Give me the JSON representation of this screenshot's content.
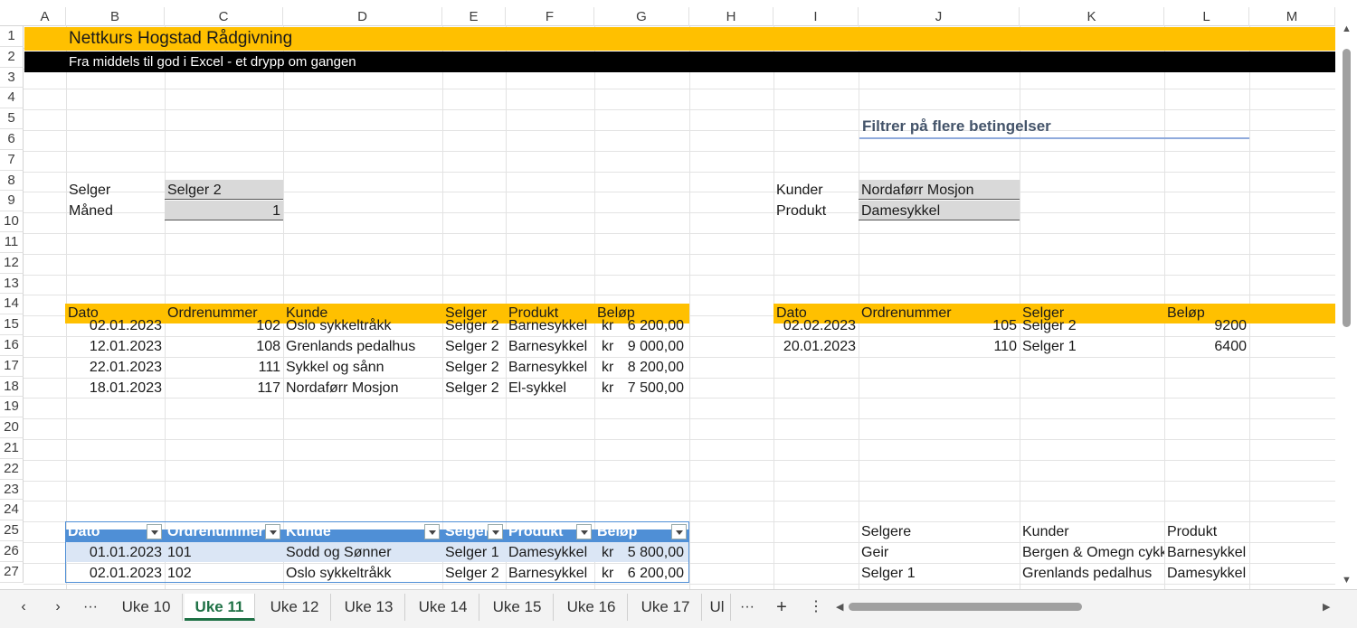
{
  "columns": [
    "A",
    "B",
    "C",
    "D",
    "E",
    "F",
    "G",
    "H",
    "I",
    "J",
    "K",
    "L",
    "M"
  ],
  "rows": [
    "1",
    "2",
    "3",
    "4",
    "5",
    "6",
    "7",
    "8",
    "9",
    "10",
    "11",
    "12",
    "13",
    "14",
    "15",
    "16",
    "17",
    "18",
    "19",
    "20",
    "21",
    "22",
    "23",
    "24",
    "25",
    "26",
    "27"
  ],
  "banner": {
    "title": "Nettkurs Hogstad Rådgivning",
    "subtitle": "Fra middels til god i Excel - et drypp om gangen"
  },
  "section_title": "Filtrer på flere betingelser",
  "criteria_left": {
    "selger_label": "Selger",
    "selger_value": "Selger 2",
    "maned_label": "Måned",
    "maned_value": "1"
  },
  "criteria_right": {
    "kunder_label": "Kunder",
    "kunder_value": "Nordaførr Mosjon",
    "produkt_label": "Produkt",
    "produkt_value": "Damesykkel"
  },
  "result_left": {
    "headers": [
      "Dato",
      "Ordrenummer",
      "Kunde",
      "Selger",
      "Produkt",
      "Beløp"
    ],
    "rows": [
      {
        "dato": "02.01.2023",
        "ordre": "102",
        "kunde": "Oslo sykkeltråkk",
        "selger": "Selger 2",
        "produkt": "Barnesykkel",
        "kr": "kr",
        "belop": "6 200,00"
      },
      {
        "dato": "12.01.2023",
        "ordre": "108",
        "kunde": "Grenlands pedalhus",
        "selger": "Selger 2",
        "produkt": "Barnesykkel",
        "kr": "kr",
        "belop": "9 000,00"
      },
      {
        "dato": "22.01.2023",
        "ordre": "111",
        "kunde": "Sykkel og sånn",
        "selger": "Selger 2",
        "produkt": "Barnesykkel",
        "kr": "kr",
        "belop": "8 200,00"
      },
      {
        "dato": "18.01.2023",
        "ordre": "117",
        "kunde": "Nordaførr Mosjon",
        "selger": "Selger 2",
        "produkt": "El-sykkel",
        "kr": "kr",
        "belop": "7 500,00"
      }
    ]
  },
  "result_right": {
    "headers": [
      "Dato",
      "Ordrenummer",
      "Selger",
      "Beløp"
    ],
    "rows": [
      {
        "dato": "02.02.2023",
        "ordre": "105",
        "selger": "Selger 2",
        "belop": "9200"
      },
      {
        "dato": "20.01.2023",
        "ordre": "110",
        "selger": "Selger 1",
        "belop": "6400"
      }
    ]
  },
  "table": {
    "headers": [
      "Dato",
      "Ordrenummer",
      "Kunde",
      "Selger",
      "Produkt",
      "Beløp"
    ],
    "rows": [
      {
        "dato": "01.01.2023",
        "ordre": "101",
        "kunde": "Sodd og Sønner",
        "selger": "Selger 1",
        "produkt": "Damesykkel",
        "kr": "kr",
        "belop": "5 800,00"
      },
      {
        "dato": "02.01.2023",
        "ordre": "102",
        "kunde": "Oslo sykkeltråkk",
        "selger": "Selger 2",
        "produkt": "Barnesykkel",
        "kr": "kr",
        "belop": "6 200,00"
      }
    ]
  },
  "lists": {
    "headers": [
      "Selgere",
      "Kunder",
      "Produkt"
    ],
    "rows": [
      [
        "Geir",
        "Bergen & Omegn cykk",
        "Barnesykkel"
      ],
      [
        "Selger 1",
        "Grenlands pedalhus",
        "Damesykkel"
      ]
    ]
  },
  "tabs": {
    "items": [
      "Uke 10",
      "Uke 11",
      "Uke 12",
      "Uke 13",
      "Uke 14",
      "Uke 15",
      "Uke 16",
      "Uke 17",
      "Ul"
    ],
    "active": "Uke 11",
    "more": "···",
    "add": "+",
    "menu": "⋮"
  },
  "colors": {
    "banner_yellow": "#ffc000",
    "banner_black": "#000000",
    "table_header": "#4f8fd6",
    "input_grey": "#d9d9d9",
    "active_tab": "#1e7145"
  }
}
